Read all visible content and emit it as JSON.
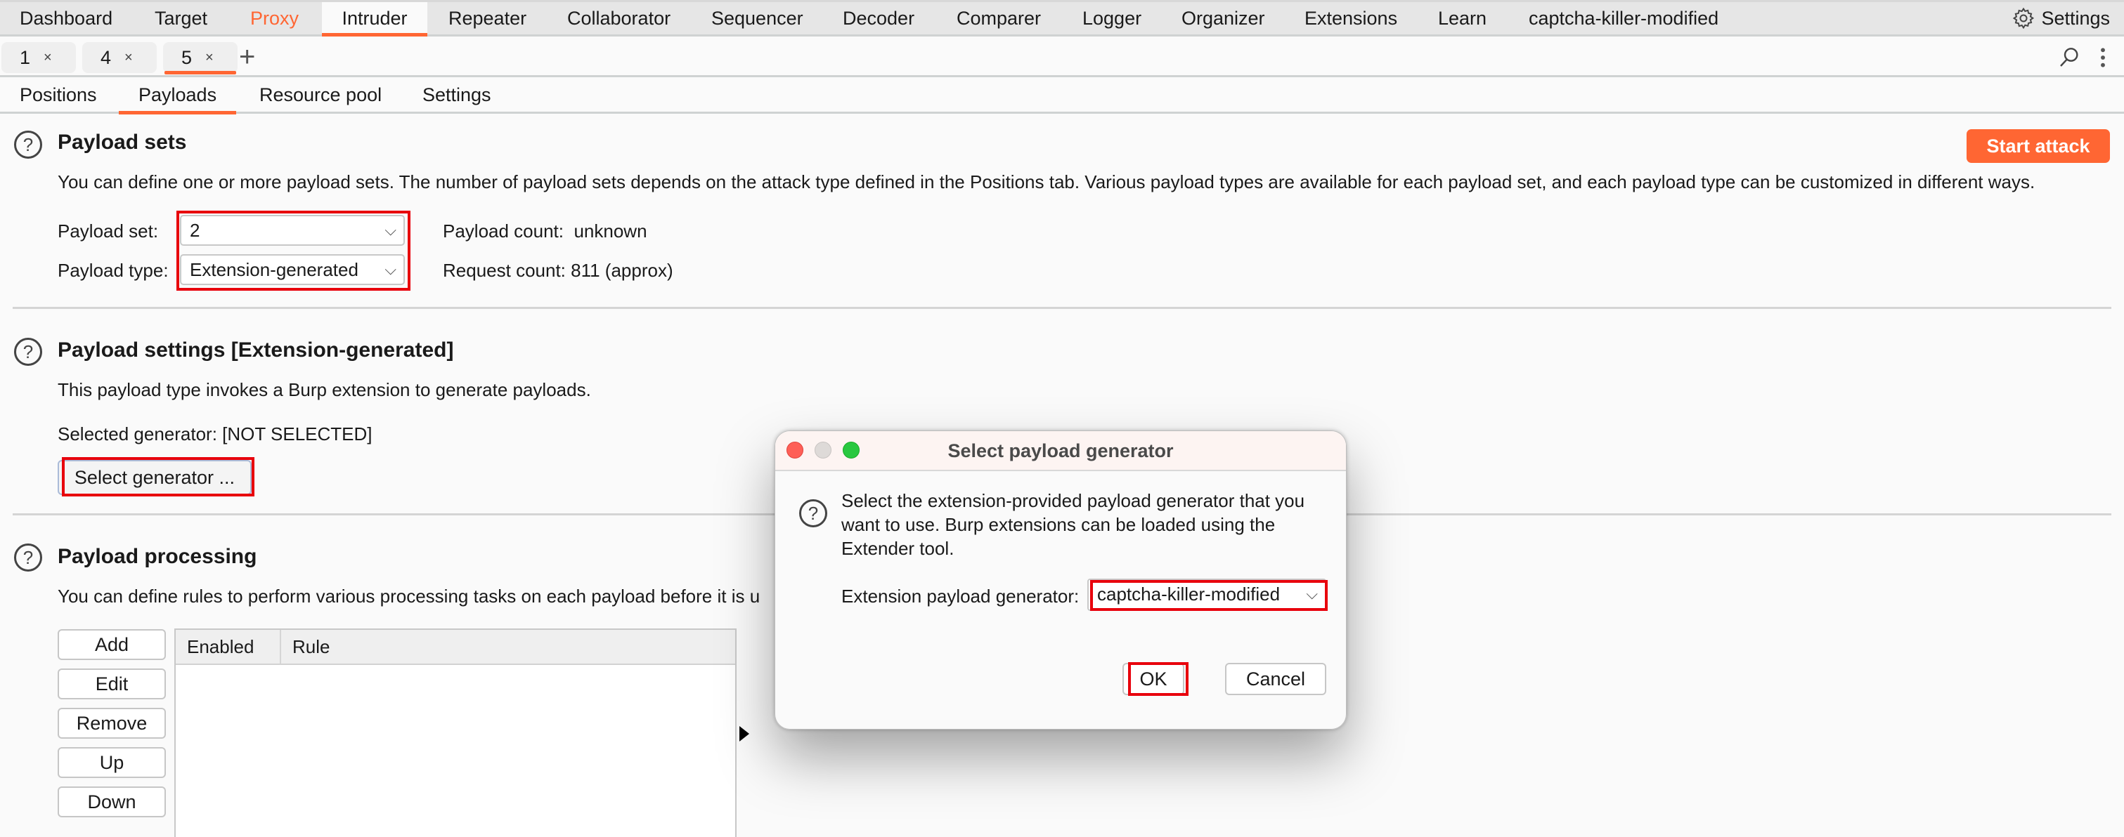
{
  "topnav": {
    "items": [
      "Dashboard",
      "Target",
      "Proxy",
      "Intruder",
      "Repeater",
      "Collaborator",
      "Sequencer",
      "Decoder",
      "Comparer",
      "Logger",
      "Organizer",
      "Extensions",
      "Learn",
      "captcha-killer-modified"
    ],
    "active": "Intruder",
    "highlighted": "Proxy",
    "settings_label": "Settings"
  },
  "request_tabs": {
    "tabs": [
      {
        "label": "1",
        "close": "×"
      },
      {
        "label": "4",
        "close": "×"
      },
      {
        "label": "5",
        "close": "×"
      }
    ],
    "active_index": 2,
    "add_label": "+"
  },
  "sub_tabs": {
    "items": [
      "Positions",
      "Payloads",
      "Resource pool",
      "Settings"
    ],
    "active": "Payloads"
  },
  "payload_sets": {
    "help": "?",
    "title": "Payload sets",
    "description": "You can define one or more payload sets. The number of payload sets depends on the attack type defined in the Positions tab. Various payload types are available for each payload set, and each payload type can be customized in different ways.",
    "set_label": "Payload set:",
    "set_value": "2",
    "type_label": "Payload type:",
    "type_value": "Extension-generated",
    "payload_count_label": "Payload count:",
    "payload_count_value": "unknown",
    "request_count_label": "Request count:",
    "request_count_value": "811 (approx)",
    "start_attack_label": "Start attack"
  },
  "payload_settings": {
    "help": "?",
    "title": "Payload settings [Extension-generated]",
    "description": "This payload type invokes a Burp extension to generate payloads.",
    "selected_generator_label": "Selected generator:",
    "selected_generator_value": "[NOT SELECTED]",
    "select_button_label": "Select generator ..."
  },
  "payload_processing": {
    "help": "?",
    "title": "Payload processing",
    "description": "You can define rules to perform various processing tasks on each payload before it is u",
    "buttons": [
      "Add",
      "Edit",
      "Remove",
      "Up",
      "Down"
    ],
    "columns": [
      "Enabled",
      "Rule"
    ],
    "rows": []
  },
  "dialog": {
    "title": "Select payload generator",
    "help": "?",
    "message": "Select the extension-provided payload generator that you want to use. Burp extensions can be loaded using the Extender tool.",
    "generator_label": "Extension payload generator:",
    "generator_value": "captcha-killer-modified",
    "ok_label": "OK",
    "cancel_label": "Cancel"
  },
  "icons": {
    "chevron": "⌵",
    "close_dialog": "close-traffic-light",
    "minimize_dialog": "minimize-traffic-light",
    "zoom_dialog": "zoom-traffic-light"
  },
  "colors": {
    "accent": "#ff6633",
    "highlight_box": "#e8000c",
    "traffic_red": "#fe5f57",
    "traffic_gray": "#dedad8",
    "traffic_green": "#28c840"
  }
}
